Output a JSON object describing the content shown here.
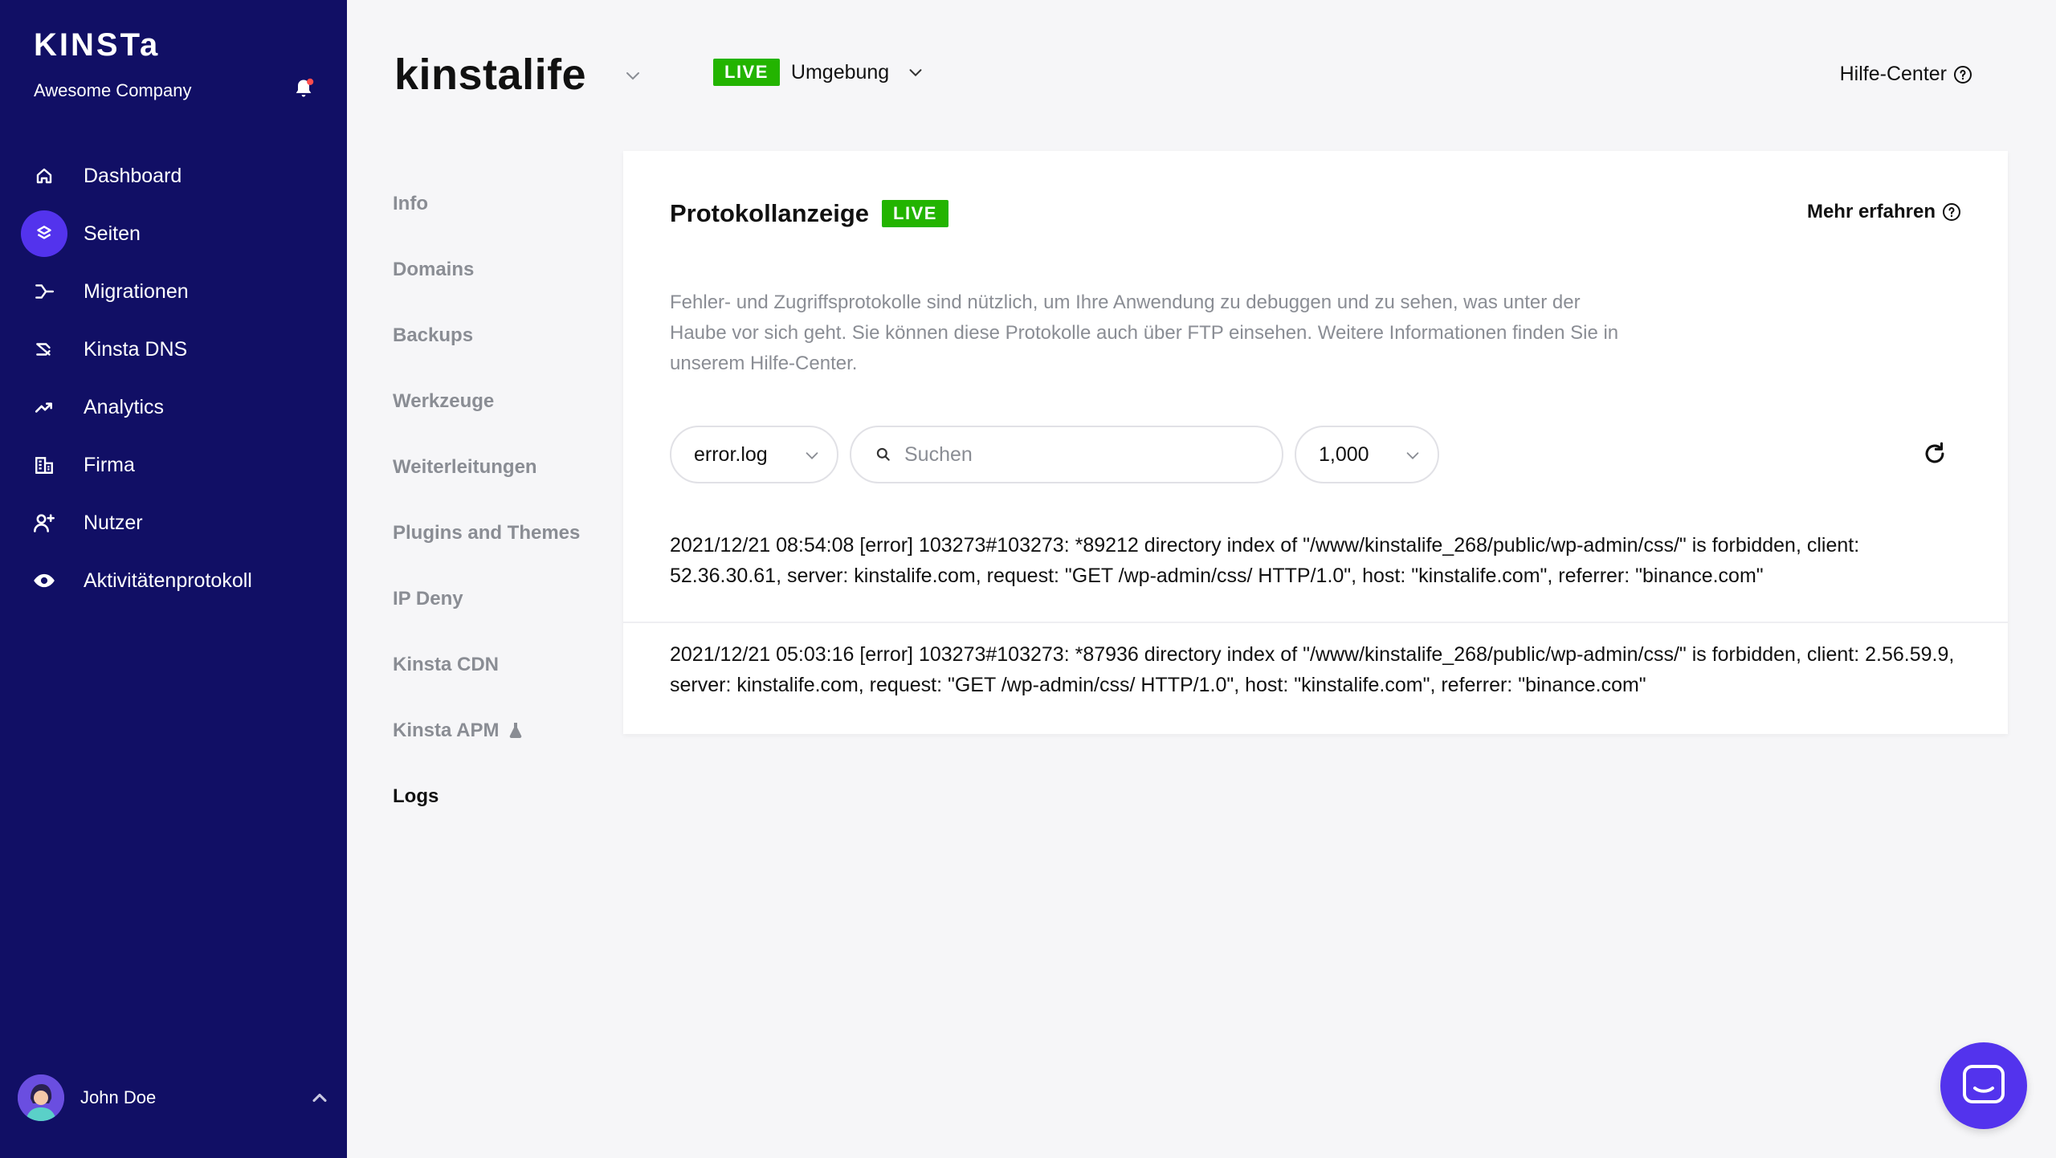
{
  "sidebar": {
    "brand": "KINSTa",
    "company": "Awesome Company",
    "items": [
      {
        "label": "Dashboard",
        "icon": "home-icon"
      },
      {
        "label": "Seiten",
        "icon": "layers-icon"
      },
      {
        "label": "Migrationen",
        "icon": "migration-icon"
      },
      {
        "label": "Kinsta DNS",
        "icon": "dns-icon"
      },
      {
        "label": "Analytics",
        "icon": "trend-icon"
      },
      {
        "label": "Firma",
        "icon": "building-icon"
      },
      {
        "label": "Nutzer",
        "icon": "add-user-icon"
      },
      {
        "label": "Aktivitätenprotokoll",
        "icon": "eye-icon"
      }
    ],
    "active_index": 1,
    "user": {
      "name": "John Doe"
    }
  },
  "header": {
    "site_name": "kinstalife",
    "env_badge": "LIVE",
    "env_label": "Umgebung",
    "help_label": "Hilfe-Center"
  },
  "subnav": {
    "items": [
      "Info",
      "Domains",
      "Backups",
      "Werkzeuge",
      "Weiterleitungen",
      "Plugins and Themes",
      "IP Deny",
      "Kinsta CDN",
      "Kinsta APM",
      "Logs"
    ],
    "active": "Logs"
  },
  "card": {
    "title": "Protokollanzeige",
    "badge": "LIVE",
    "learn_more": "Mehr erfahren",
    "description": "Fehler- und Zugriffsprotokolle sind nützlich, um Ihre Anwendung zu debuggen und zu sehen, was unter der Haube vor sich geht. Sie können diese Protokolle auch über FTP einsehen. Weitere Informationen finden Sie in unserem Hilfe-Center.",
    "log_file": "error.log",
    "search_placeholder": "Suchen",
    "line_count": "1,000",
    "logs": [
      "2021/12/21 08:54:08 [error] 103273#103273: *89212 directory index of \"/www/kinstalife_268/public/wp-admin/css/\" is forbidden, client: 52.36.30.61, server: kinstalife.com, request: \"GET /wp-admin/css/ HTTP/1.0\", host: \"kinstalife.com\", referrer: \"binance.com\"",
      "2021/12/21 05:03:16 [error] 103273#103273: *87936 directory index of \"/www/kinstalife_268/public/wp-admin/css/\" is forbidden, client: 2.56.59.9, server: kinstalife.com, request: \"GET /wp-admin/css/ HTTP/1.0\", host: \"kinstalife.com\", referrer: \"binance.com\""
    ]
  },
  "colors": {
    "sidebar_bg": "#110f65",
    "accent": "#5333ed",
    "live_green": "#23b400",
    "muted_text": "#8a8d94"
  }
}
